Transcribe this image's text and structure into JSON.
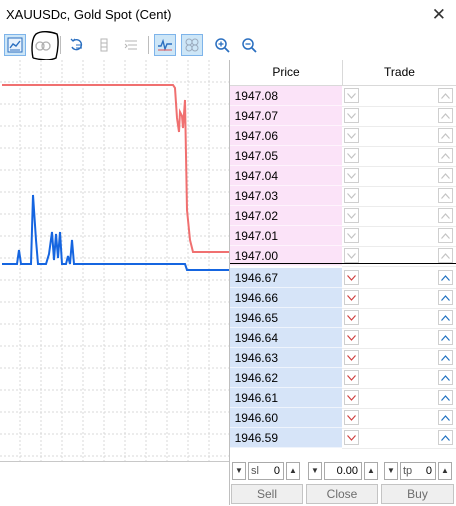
{
  "window": {
    "title": "XAUUSDc, Gold Spot (Cent)",
    "close_glyph": "✕"
  },
  "toolbar": {
    "buttons": [
      {
        "name": "chart-mode-icon",
        "active": true
      },
      {
        "name": "trade-levels-icon",
        "active": false
      },
      {
        "name": "auto-scroll-icon",
        "active": false
      },
      {
        "name": "depth-icon",
        "active": false
      },
      {
        "name": "ticks-list-icon",
        "active": false
      },
      {
        "name": "tick-chart-icon",
        "active": true
      },
      {
        "name": "bubbles-icon",
        "active": true
      },
      {
        "name": "zoom-in-icon",
        "active": false
      },
      {
        "name": "zoom-out-icon",
        "active": false
      }
    ]
  },
  "depth_of_market": {
    "headers": {
      "price": "Price",
      "trade": "Trade"
    },
    "ask_prices": [
      "1947.08",
      "1947.07",
      "1947.06",
      "1947.05",
      "1947.04",
      "1947.03",
      "1947.02",
      "1947.01",
      "1947.00"
    ],
    "bid_prices": [
      "1946.67",
      "1946.66",
      "1946.65",
      "1946.64",
      "1946.63",
      "1946.62",
      "1946.61",
      "1946.60",
      "1946.59"
    ]
  },
  "controls": {
    "sl_label": "sl",
    "sl_value": "0",
    "volume_value": "0.00",
    "tp_label": "tp",
    "tp_value": "0",
    "sell_label": "Sell",
    "close_label": "Close",
    "buy_label": "Buy"
  },
  "colors": {
    "ask_line": "#f07070",
    "bid_line": "#1565e0",
    "ask_bg": "#fbe3f8",
    "bid_bg": "#d6e4f8",
    "down_arrow": "#d04040",
    "up_arrow": "#2070c0"
  }
}
